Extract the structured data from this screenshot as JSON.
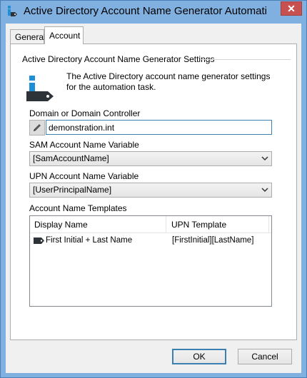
{
  "window": {
    "title": "Active Directory Account Name Generator Automati",
    "close_label": "✕"
  },
  "tabs": [
    {
      "label": "General",
      "active": false
    },
    {
      "label": "Account",
      "active": true
    }
  ],
  "group": {
    "title": "Active Directory Account Name Generator Settings",
    "description": "The Active Directory account name generator settings for the automation task."
  },
  "domain": {
    "label": "Domain or Domain Controller",
    "value": "demonstration.int"
  },
  "sam": {
    "label": "SAM Account Name Variable",
    "selected": "[SamAccountName]"
  },
  "upn": {
    "label": "UPN Account Name Variable",
    "selected": "[UserPrincipalName]"
  },
  "templates": {
    "label": "Account Name Templates",
    "columns": [
      "Display Name",
      "UPN Template"
    ],
    "rows": [
      {
        "display_name": "First Initial + Last Name",
        "upn_template": "[FirstInitial][LastName]"
      }
    ]
  },
  "buttons": {
    "ok": "OK",
    "cancel": "Cancel"
  },
  "icons": {
    "app": "ad-tag-icon",
    "info": "info-tag-icon",
    "pencil": "pencil-icon",
    "row": "tag-icon",
    "dropdown": "chevron-down-icon"
  },
  "colors": {
    "titlebar": "#7fb0e0",
    "close": "#c75050",
    "accent": "#3c7fb1",
    "icon_blue": "#1e8fd6",
    "icon_dark": "#2d3338"
  }
}
